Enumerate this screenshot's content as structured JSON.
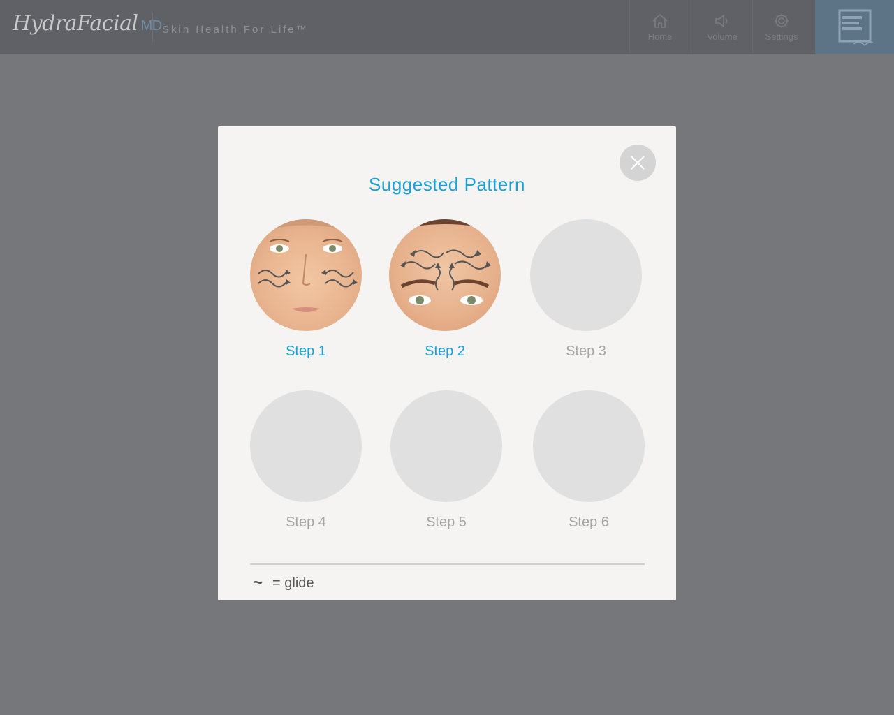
{
  "header": {
    "brand": "HydraFacial",
    "brand_suffix": "MD",
    "tagline": "Skin Health For Life™",
    "nav": [
      {
        "label": "Home",
        "icon": "home-icon"
      },
      {
        "label": "Volume",
        "icon": "speaker-icon"
      },
      {
        "label": "Settings",
        "icon": "gear-icon"
      }
    ],
    "edge_logo": "edge-for-life-logo"
  },
  "modal": {
    "title": "Suggested Pattern",
    "steps": [
      {
        "label": "Step 1",
        "active": true,
        "image": "face-cheeks-glide-pattern"
      },
      {
        "label": "Step 2",
        "active": true,
        "image": "forehead-glide-pattern"
      },
      {
        "label": "Step 3",
        "active": false
      },
      {
        "label": "Step 4",
        "active": false
      },
      {
        "label": "Step 5",
        "active": false
      },
      {
        "label": "Step 6",
        "active": false
      }
    ],
    "legend": {
      "symbol": "~",
      "text": "= glide"
    }
  },
  "colors": {
    "accent": "#1aa0d6",
    "overlay": "#76777b",
    "header": "#606166",
    "modal_bg": "#f5f4f2",
    "placeholder": "#e0e0e0"
  }
}
